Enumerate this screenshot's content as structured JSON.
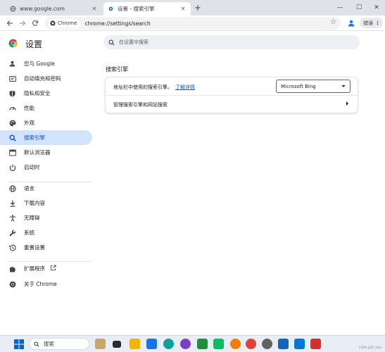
{
  "browser": {
    "tabs": [
      {
        "title": "www.google.com",
        "active": false
      },
      {
        "title": "设置 - 搜索引擎",
        "active": true
      }
    ],
    "new_tab": "+",
    "window_controls": {
      "minimize": "—",
      "maximize": "☐",
      "close": "✕"
    },
    "omnibox": {
      "chip": "Chrome",
      "url": "chrome://settings/search"
    },
    "error_button": "错误"
  },
  "settings": {
    "title": "设置",
    "search_placeholder": "在设置中搜索",
    "sidebar": [
      {
        "label": "您与 Google",
        "icon": "person-icon",
        "active": false
      },
      {
        "label": "自动填充和密码",
        "icon": "autofill-icon",
        "active": false
      },
      {
        "label": "隐私和安全",
        "icon": "shield-icon",
        "active": false
      },
      {
        "label": "性能",
        "icon": "speedometer-icon",
        "active": false
      },
      {
        "label": "外观",
        "icon": "palette-icon",
        "active": false
      },
      {
        "label": "搜索引擎",
        "icon": "search-icon",
        "active": true
      },
      {
        "label": "默认浏览器",
        "icon": "browser-icon",
        "active": false
      },
      {
        "label": "启动时",
        "icon": "power-icon",
        "active": false
      },
      {
        "label": "语言",
        "icon": "globe-icon",
        "active": false
      },
      {
        "label": "下载内容",
        "icon": "download-icon",
        "active": false
      },
      {
        "label": "无障碍",
        "icon": "accessibility-icon",
        "active": false
      },
      {
        "label": "系统",
        "icon": "wrench-icon",
        "active": false
      },
      {
        "label": "重置设置",
        "icon": "history-icon",
        "active": false
      },
      {
        "label": "扩展程序",
        "icon": "puzzle-icon",
        "active": false
      },
      {
        "label": "关于 Chrome",
        "icon": "chrome-icon",
        "active": false
      }
    ],
    "section_title": "搜索引擎",
    "address_bar_label": "地址栏中使用的搜索引擎。",
    "learn_more": "了解详情",
    "engine_selected": "Microsoft Bing",
    "manage_label": "管理搜索引擎和网站搜索"
  },
  "taskbar": {
    "search_placeholder": "搜索",
    "watermark": "CSDN @ZP_Jitter"
  },
  "colors": {
    "accent": "#0b57d0",
    "active_bg": "#d3e3fd",
    "tabstrip": "#dfe3e8",
    "taskbar": "#e9eef5"
  }
}
